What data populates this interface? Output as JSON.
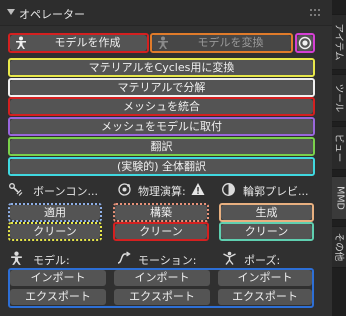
{
  "panel": {
    "title": "オペレーター"
  },
  "tabs": [
    {
      "label": "アイテム"
    },
    {
      "label": "ツール"
    },
    {
      "label": "ビュー"
    },
    {
      "label": "MMD"
    },
    {
      "label": "その他"
    }
  ],
  "top_row": {
    "make_model": "モデルを作成",
    "convert_model": "モデルを変換"
  },
  "actions": {
    "cycles": "マテリアルをCycles用に変換",
    "separate": "マテリアルで分解",
    "join": "メッシュを統合",
    "attach": "メッシュをモデルに取付",
    "translate": "翻訳",
    "global_translate": "(実験的) 全体翻訳"
  },
  "sections": {
    "bone": {
      "label": "ボーンコン...",
      "apply": "適用",
      "clean": "クリーン"
    },
    "physics": {
      "label": "物理演算:",
      "build": "構築",
      "clean": "クリーン"
    },
    "edge": {
      "label": "輪郭プレビ...",
      "generate": "生成",
      "clean": "クリーン"
    }
  },
  "io": {
    "model_label": "モデル:",
    "motion_label": "モーション:",
    "pose_label": "ポーズ:",
    "import": "インポート",
    "export": "エクスポート"
  },
  "colors": {
    "red": "#d42020",
    "orange": "#e07b2a",
    "magenta": "#d43fd4",
    "yellow": "#e8e84a",
    "white": "#f0f0f0",
    "purple": "#9966dd",
    "green": "#7ad14a",
    "cyan": "#40d8e0",
    "blue": "#2d6fd6",
    "dot_blue": "#8fb0e8",
    "dot_salmon": "#e8937a",
    "dot_peach": "#e8b080"
  }
}
